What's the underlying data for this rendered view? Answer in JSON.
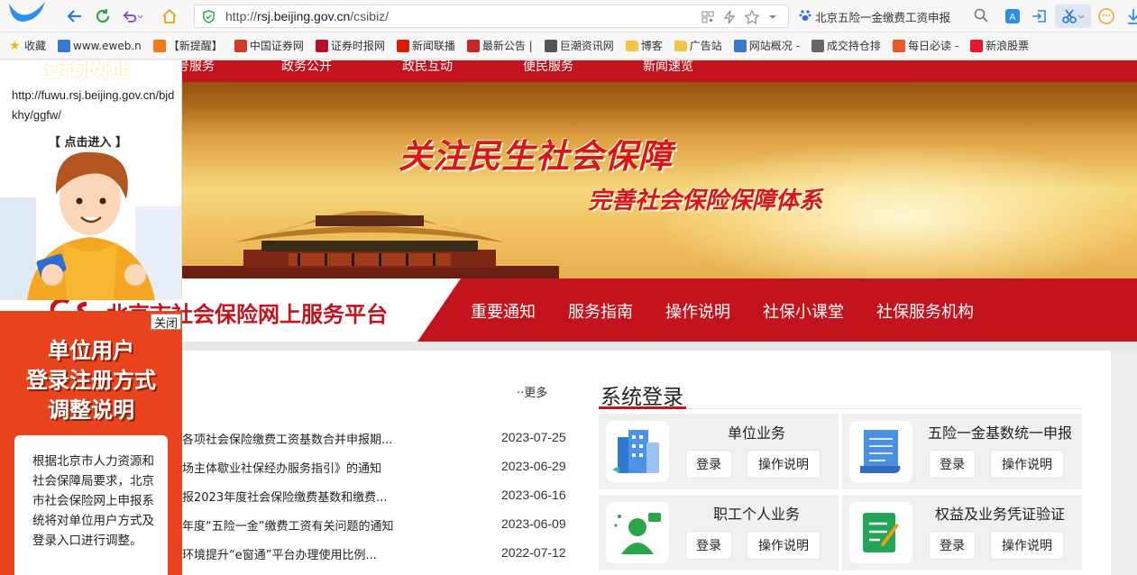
{
  "browser": {
    "url_prefix": "http://",
    "url_host": "rsj.beijing.gov.cn",
    "url_path": "/csibiz/",
    "search_text": "北京五险一金缴费工资申报"
  },
  "bookmarks": [
    {
      "label": "收藏",
      "icon": "star-icon",
      "color": "#f5b400"
    },
    {
      "label": "www.eweb.n",
      "icon": "eweb-icon",
      "color": "#3a78c9"
    },
    {
      "label": "【新提醒】",
      "icon": "site-icon",
      "color": "#f07a1a"
    },
    {
      "label": "中国证券网",
      "icon": "site-icon",
      "color": "#d33a2a"
    },
    {
      "label": "证券时报网",
      "icon": "site-icon",
      "color": "#b3122a"
    },
    {
      "label": "新闻联播",
      "icon": "site-icon",
      "color": "#d81e06"
    },
    {
      "label": "最新公告 |",
      "icon": "site-icon",
      "color": "#c62828"
    },
    {
      "label": "巨潮资讯网",
      "icon": "doc-icon",
      "color": "#555555"
    },
    {
      "label": "博客",
      "icon": "folder-icon",
      "color": "#f4c542"
    },
    {
      "label": "广告站",
      "icon": "folder-icon",
      "color": "#f4c542"
    },
    {
      "label": "网站概况 -",
      "icon": "chart-icon",
      "color": "#3a78c9"
    },
    {
      "label": "成交持仓排",
      "icon": "site-icon",
      "color": "#666666"
    },
    {
      "label": "每日必读 -",
      "icon": "site-icon",
      "color": "#e05a2b"
    },
    {
      "label": "新浪股票",
      "icon": "weibo-icon",
      "color": "#e6162d"
    }
  ],
  "site": {
    "top_nav": [
      "号服务",
      "政务公开",
      "政民互动",
      "便民服务",
      "新闻速览"
    ],
    "slogan_main": "关注民生社会保障",
    "slogan_sub": "完善社会保险保障体系",
    "title": "北京市社会保险网上服务平台",
    "main_nav": [
      "重要通知",
      "服务指南",
      "操作说明",
      "社保小课堂",
      "社保服务机构"
    ]
  },
  "news": {
    "more_label": "··更多",
    "items": [
      {
        "title": "各项社会保险缴费工资基数合并申报期...",
        "date": "2023-07-25"
      },
      {
        "title": "场主体歇业社保经办服务指引》的通知",
        "date": "2023-06-29"
      },
      {
        "title": "报2023年度社会保险缴费基数和缴费...",
        "date": "2023-06-16"
      },
      {
        "title": "年度“五险一金”缴费工资有关问题的通知",
        "date": "2023-06-09"
      },
      {
        "title": "环境提升“e窗通”平台办理使用比例...",
        "date": "2022-07-12"
      }
    ]
  },
  "login": {
    "title": "系统登录",
    "cards": [
      {
        "name": "单位业务",
        "icon": "building-icon",
        "login": "登录",
        "guide": "操作说明"
      },
      {
        "name": "五险一金基数统一申报",
        "icon": "scroll-icon",
        "login": "登录",
        "guide": "操作说明"
      },
      {
        "name": "职工个人业务",
        "icon": "person-chat-icon",
        "login": "登录",
        "guide": "操作说明"
      },
      {
        "name": "权益及业务凭证验证",
        "icon": "certificate-icon",
        "login": "登录",
        "guide": "操作说明"
      }
    ]
  },
  "ad_query": {
    "heading": "查询网址",
    "url": "http://fuwu.rsj.beijing.gov.cn/bjdkhy/ggfw/",
    "enter": "【 点击进入 】"
  },
  "ad_notice": {
    "close": "关闭",
    "heading_lines": [
      "单位用户",
      "登录注册方式",
      "调整说明"
    ],
    "body": "根据北京市人力资源和社会保障局要求，北京市社会保险网上申报系统将对单位用户方式及登录入口进行调整。"
  },
  "colors": {
    "brand_red": "#c3141e",
    "ad_orange": "#e9431d"
  }
}
